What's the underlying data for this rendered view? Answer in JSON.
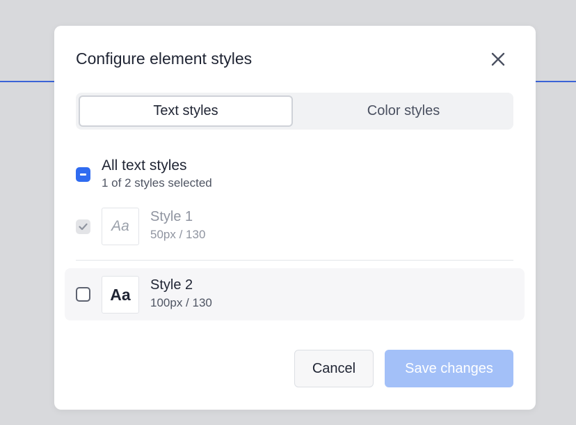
{
  "dialog": {
    "title": "Configure element styles"
  },
  "tabs": [
    {
      "label": "Text styles",
      "active": true
    },
    {
      "label": "Color styles",
      "active": false
    }
  ],
  "all_styles": {
    "label": "All text styles",
    "summary": "1 of 2 styles selected",
    "state": "indeterminate"
  },
  "styles": [
    {
      "name": "Style 1",
      "meta": "50px / 130",
      "preview": "Aa",
      "checked": true,
      "disabled": true
    },
    {
      "name": "Style 2",
      "meta": "100px / 130",
      "preview": "Aa",
      "checked": false,
      "disabled": false
    }
  ],
  "buttons": {
    "cancel": "Cancel",
    "save": "Save changes"
  },
  "colors": {
    "accent": "#2f6bf0",
    "save_disabled": "#a3c0f8",
    "backdrop": "#d8d9dc"
  }
}
